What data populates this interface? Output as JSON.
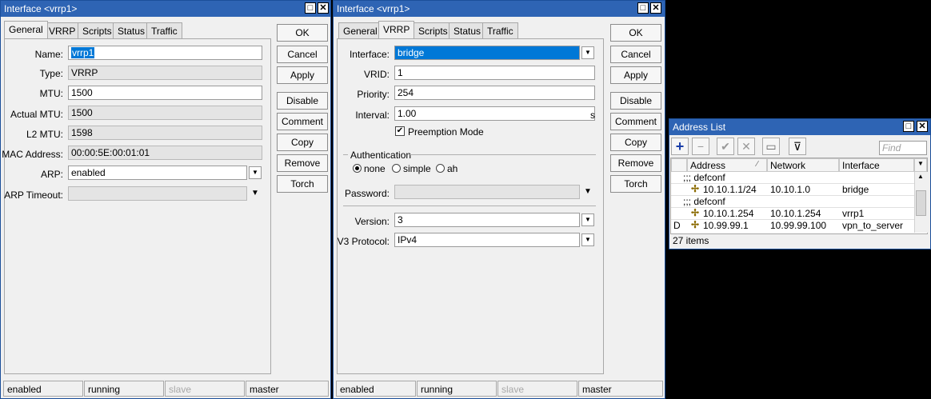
{
  "win1": {
    "title": "Interface <vrrp1>",
    "tabs": [
      "General",
      "VRRP",
      "Scripts",
      "Status",
      "Traffic"
    ],
    "fields": {
      "name_label": "Name:",
      "name_value": "vrrp1",
      "type_label": "Type:",
      "type_value": "VRRP",
      "mtu_label": "MTU:",
      "mtu_value": "1500",
      "actual_mtu_label": "Actual MTU:",
      "actual_mtu_value": "1500",
      "l2_mtu_label": "L2 MTU:",
      "l2_mtu_value": "1598",
      "mac_label": "MAC Address:",
      "mac_value": "00:00:5E:00:01:01",
      "arp_label": "ARP:",
      "arp_value": "enabled",
      "arp_timeout_label": "ARP Timeout:",
      "arp_timeout_value": ""
    },
    "buttons": [
      "OK",
      "Cancel",
      "Apply",
      "Disable",
      "Comment",
      "Copy",
      "Remove",
      "Torch"
    ],
    "status": [
      "enabled",
      "running",
      "slave",
      "master"
    ]
  },
  "win2": {
    "title": "Interface <vrrp1>",
    "tabs": [
      "General",
      "VRRP",
      "Scripts",
      "Status",
      "Traffic"
    ],
    "fields": {
      "interface_label": "Interface:",
      "interface_value": "bridge",
      "vrid_label": "VRID:",
      "vrid_value": "1",
      "priority_label": "Priority:",
      "priority_value": "254",
      "interval_label": "Interval:",
      "interval_value": "1.00",
      "interval_unit": "s",
      "preemption_label": "Preemption Mode",
      "auth_header": "Authentication",
      "auth_none": "none",
      "auth_simple": "simple",
      "auth_ah": "ah",
      "password_label": "Password:",
      "password_value": "",
      "version_label": "Version:",
      "version_value": "3",
      "v3_label": "V3 Protocol:",
      "v3_value": "IPv4"
    },
    "buttons": [
      "OK",
      "Cancel",
      "Apply",
      "Disable",
      "Comment",
      "Copy",
      "Remove",
      "Torch"
    ],
    "status": [
      "enabled",
      "running",
      "slave",
      "master"
    ]
  },
  "addr": {
    "title": "Address List",
    "find_placeholder": "Find",
    "columns": [
      "Address",
      "Network",
      "Interface"
    ],
    "rows": [
      {
        "flag": "",
        "comment": ";;; defconf"
      },
      {
        "flag": "",
        "address": "10.10.1.1/24",
        "network": "10.10.1.0",
        "interface": "bridge"
      },
      {
        "flag": "",
        "comment": ";;; defconf"
      },
      {
        "flag": "",
        "address": "10.10.1.254",
        "network": "10.10.1.254",
        "interface": "vrrp1"
      },
      {
        "flag": "D",
        "address": "10.99.99.1",
        "network": "10.99.99.100",
        "interface": "vpn_to_server"
      }
    ],
    "count": "27 items"
  },
  "colors": {
    "titlebar": "#2e64b4",
    "selection": "#0078d7",
    "window_bg": "#f0f0f0"
  }
}
